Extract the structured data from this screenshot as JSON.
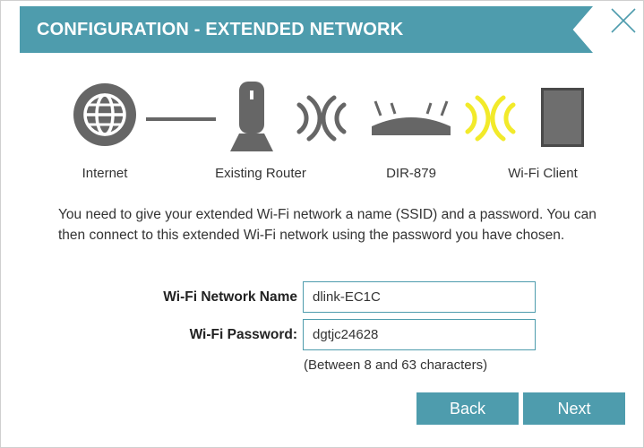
{
  "header": {
    "title": "CONFIGURATION - EXTENDED NETWORK",
    "color": "#4e9cad"
  },
  "diagram": {
    "labels": {
      "internet": "Internet",
      "existing_router": "Existing Router",
      "dir": "DIR-879",
      "client": "Wi-Fi Client"
    },
    "icons": [
      "globe-icon",
      "router-icon",
      "wifi-signal-icon",
      "extender-icon",
      "wifi-signal-icon",
      "tablet-icon"
    ],
    "active_signal_color": "#f2ea2a"
  },
  "description": "You need to give your extended Wi-Fi network a name (SSID) and a password. You can then connect to this extended Wi-Fi network using the password you have chosen.",
  "form": {
    "ssid_label": "Wi-Fi Network Name",
    "ssid_value": "dlink-EC1C",
    "password_label": "Wi-Fi Password:",
    "password_value": "dgtjc24628",
    "password_hint": "(Between 8 and 63 characters)"
  },
  "buttons": {
    "back": "Back",
    "next": "Next"
  }
}
